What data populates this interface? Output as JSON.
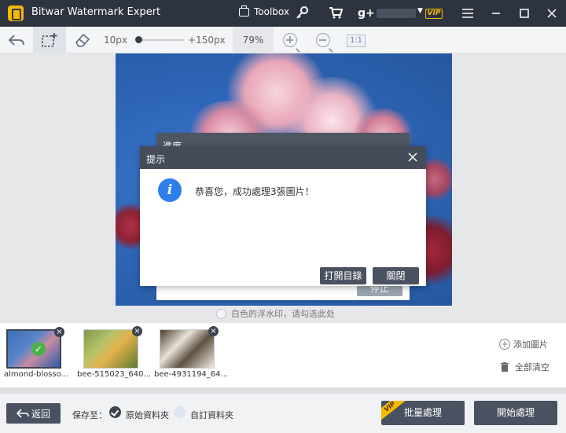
{
  "app": {
    "title": "Bitwar Watermark Expert",
    "toolbox_label": "Toolbox",
    "vip_label": "VIP"
  },
  "toolbar": {
    "size_min": "10px",
    "size_max": "+150px",
    "size_level": 0.0,
    "zoom": "79%",
    "one_to_one": "1:1"
  },
  "canvas": {
    "hint": "白色的浮水印，请勾选此处"
  },
  "progress_dialog": {
    "title": "進度",
    "stop_label": "停止"
  },
  "dialog": {
    "title": "提示",
    "message": "恭喜您，成功處理3張圖片！",
    "open_dir_label": "打開目錄",
    "close_label": "關閉"
  },
  "thumbnails": [
    {
      "name": "almond-blosso...",
      "selected": true
    },
    {
      "name": "bee-515023_640...",
      "selected": false
    },
    {
      "name": "bee-4931194_64...",
      "selected": false
    }
  ],
  "side_actions": {
    "add": "添加圖片",
    "clear": "全部清空"
  },
  "bottom": {
    "back_label": "返回",
    "save_to_label": "保存至：",
    "option_original": "原始資料夾",
    "option_custom": "自訂資料夾",
    "selected_option": "original",
    "batch_label": "批量處理",
    "batch_vip": "VIP",
    "start_label": "開始處理"
  },
  "colors": {
    "titlebar": "#2d3440",
    "accent_vip": "#f5b800",
    "button": "#4a5261",
    "info": "#2f7fea",
    "check": "#49b34a"
  }
}
